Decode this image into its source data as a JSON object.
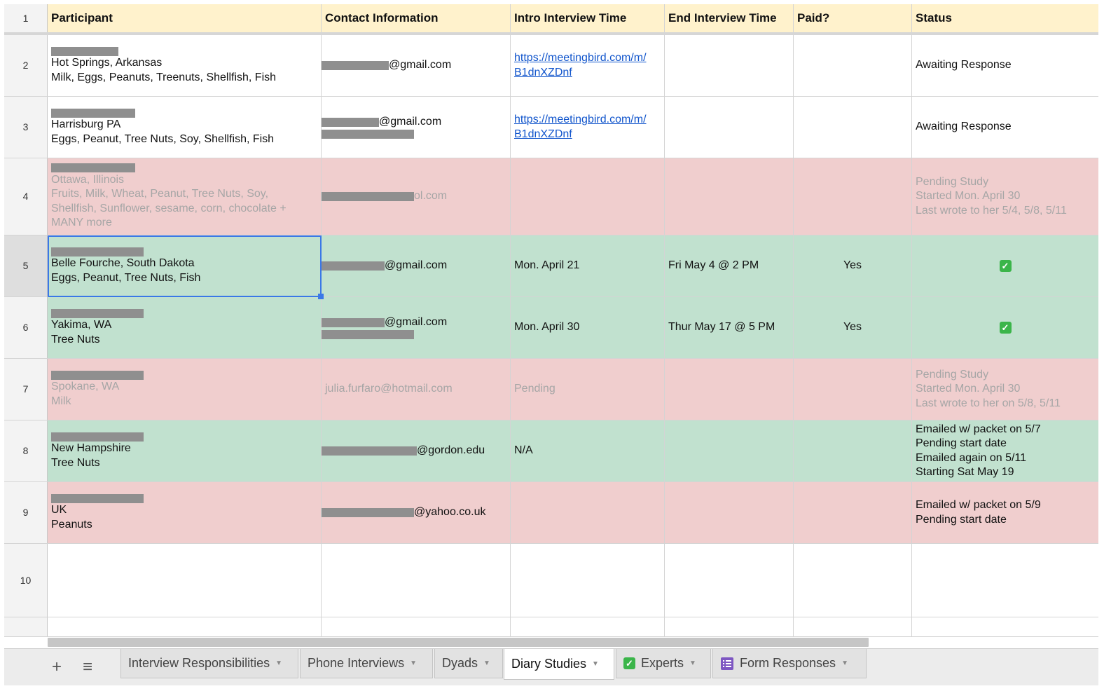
{
  "columns": {
    "row_header": "1",
    "participant": "Participant",
    "contact": "Contact Information",
    "intro_time": "Intro Interview Time",
    "end_time": "End Interview Time",
    "paid": "Paid?",
    "status": "Status"
  },
  "rows": [
    {
      "num": "2",
      "loc": "Hot Springs, Arkansas",
      "allergens": "Milk, Eggs, Peanuts, Treenuts, Shellfish, Fish",
      "contact": "@gmail.com",
      "intro_link": [
        "https://meetingbird.com/m/",
        "B1dnXZDnf"
      ],
      "status": "Awaiting Response"
    },
    {
      "num": "3",
      "loc": "Harrisburg PA",
      "allergens": "Eggs, Peanut, Tree Nuts, Soy, Shellfish, Fish",
      "contact": "@gmail.com",
      "intro_link": [
        "https://meetingbird.com/m/",
        "B1dnXZDnf"
      ],
      "status": "Awaiting Response"
    },
    {
      "num": "4",
      "loc": "Ottawa, Illinois",
      "allergens": [
        "Fruits, Milk, Wheat, Peanut, Tree Nuts, Soy,",
        "Shellfish, Sunflower, sesame, corn, chocolate +",
        "MANY more"
      ],
      "contact": "ol.com",
      "status": [
        "Pending Study",
        "Started Mon. April 30",
        "Last wrote to her 5/4, 5/8, 5/11"
      ]
    },
    {
      "num": "5",
      "loc": "Belle Fourche, South Dakota",
      "allergens": "Eggs, Peanut, Tree Nuts, Fish",
      "contact": "@gmail.com",
      "intro": "Mon. April 21",
      "end": "Fri May 4 @ 2 PM",
      "paid": "Yes",
      "status_icon": "check-mark-icon"
    },
    {
      "num": "6",
      "loc": "Yakima, WA",
      "allergens": "Tree Nuts",
      "contact": "@gmail.com",
      "intro": "Mon. April 30",
      "end": "Thur May 17 @ 5 PM",
      "paid": "Yes",
      "status_icon": "check-mark-icon"
    },
    {
      "num": "7",
      "loc": "Spokane, WA",
      "allergens": "Milk",
      "contact": "julia.furfaro@hotmail.com",
      "intro": "Pending",
      "status": [
        "Pending Study",
        "Started Mon. April 30",
        "Last wrote to her on 5/8, 5/11"
      ]
    },
    {
      "num": "8",
      "loc": "New Hampshire",
      "allergens": "Tree Nuts",
      "contact": "@gordon.edu",
      "intro": "N/A",
      "status": [
        "Emailed w/ packet on 5/7",
        "Pending start date",
        "Emailed again on 5/11",
        "Starting Sat May 19"
      ]
    },
    {
      "num": "9",
      "loc": "UK",
      "allergens": "Peanuts",
      "contact": "@yahoo.co.uk",
      "status": [
        "Emailed w/ packet on 5/9",
        "Pending start date"
      ]
    },
    {
      "num": "10"
    }
  ],
  "check_glyph": "✓",
  "toolbar": {
    "add_sheet": "+",
    "all_sheets": "≡"
  },
  "tabs": [
    {
      "label": "Interview Responsibilities"
    },
    {
      "label": "Phone Interviews"
    },
    {
      "label": "Dyads"
    },
    {
      "label": "Diary Studies"
    },
    {
      "label": "Experts"
    },
    {
      "label": "Form Responses"
    }
  ],
  "caret": "▼",
  "colors": {
    "header_bg": "#fff2cc",
    "pink_row": "#f0cece",
    "green_row": "#c1e1cf",
    "link": "#1155cc",
    "selection": "#3b78e7"
  }
}
